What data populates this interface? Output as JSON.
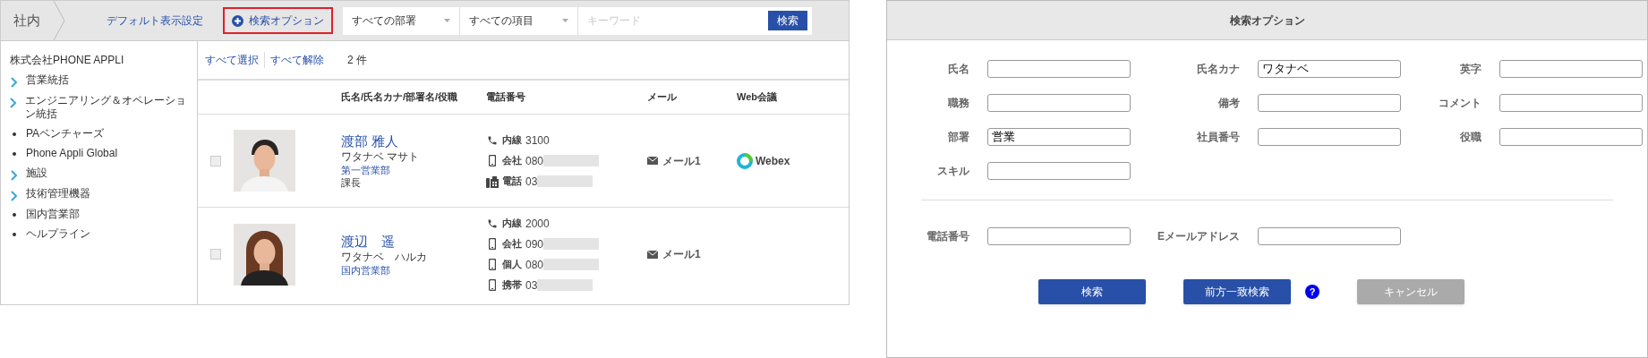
{
  "toolbar": {
    "breadcrumb": "社内",
    "default_view_link": "デフォルト表示設定",
    "search_option_button": {
      "label": "検索オプション",
      "highlighted": true
    },
    "department_select": "すべての部署",
    "item_select": "すべての項目",
    "keyword_placeholder": "キーワード",
    "search_button": "検索"
  },
  "sidebar": {
    "company": "株式会社PHONE APPLI",
    "items": [
      {
        "label": "営業統括",
        "kind": "group"
      },
      {
        "label": "エンジニアリング＆オペレーション統括",
        "kind": "group"
      },
      {
        "label": "PAベンチャーズ",
        "kind": "leaf"
      },
      {
        "label": "Phone Appli Global",
        "kind": "leaf"
      },
      {
        "label": "施設",
        "kind": "group"
      },
      {
        "label": "技術管理機器",
        "kind": "group"
      },
      {
        "label": "国内営業部",
        "kind": "leaf"
      },
      {
        "label": "ヘルプライン",
        "kind": "leaf"
      }
    ]
  },
  "results": {
    "select_all": "すべて選択",
    "deselect_all": "すべて解除",
    "count": "2 件",
    "columns": [
      "氏名/氏名カナ/部署名/役職",
      "電話番号",
      "メール",
      "Web会議"
    ],
    "rows": [
      {
        "checked": false,
        "photo": {
          "kind": "picture"
        },
        "name": "渡部 雅人",
        "kana": "ワタナベ マサト",
        "department": "第一営業部",
        "title": "課長",
        "phones": [
          {
            "kind": "extension",
            "label": "内線",
            "number": "3100",
            "masked": false
          },
          {
            "kind": "mobile",
            "label": "会社",
            "number": "080",
            "masked": true
          },
          {
            "kind": "fax",
            "label": "電話",
            "number": "03",
            "masked": true
          }
        ],
        "mail": "メール1",
        "web_meeting": "Webex"
      },
      {
        "checked": false,
        "photo": {
          "kind": "picture"
        },
        "name": "渡辺　遥",
        "kana": "ワタナベ　ハルカ",
        "department": "国内営業部",
        "phones": [
          {
            "kind": "extension",
            "label": "内線",
            "number": "2000",
            "masked": false
          },
          {
            "kind": "mobile",
            "label": "会社",
            "number": "090",
            "masked": true
          },
          {
            "kind": "mobile",
            "label": "個人",
            "number": "080",
            "masked": true
          },
          {
            "kind": "mobile",
            "label": "携帯",
            "number": "03",
            "masked": true
          }
        ],
        "mail": "メール1"
      }
    ]
  },
  "dialog": {
    "title": "検索オプション",
    "fields": [
      {
        "label": "氏名"
      },
      {
        "label": "氏名カナ",
        "value": "ワタナベ"
      },
      {
        "label": "英字"
      },
      {
        "label": "職務"
      },
      {
        "label": "備考"
      },
      {
        "label": "コメント"
      },
      {
        "label": "部署",
        "value": "営業"
      },
      {
        "label": "社員番号"
      },
      {
        "label": "役職"
      },
      {
        "label": "スキル"
      }
    ],
    "contact_fields": [
      {
        "label": "電話番号"
      },
      {
        "label": "Eメールアドレス"
      }
    ],
    "buttons": [
      {
        "label": "検索",
        "disabled": false
      },
      {
        "label": "前方一致検索",
        "disabled": false,
        "help": "?"
      },
      {
        "label": "キャンセル",
        "disabled": true
      }
    ]
  }
}
